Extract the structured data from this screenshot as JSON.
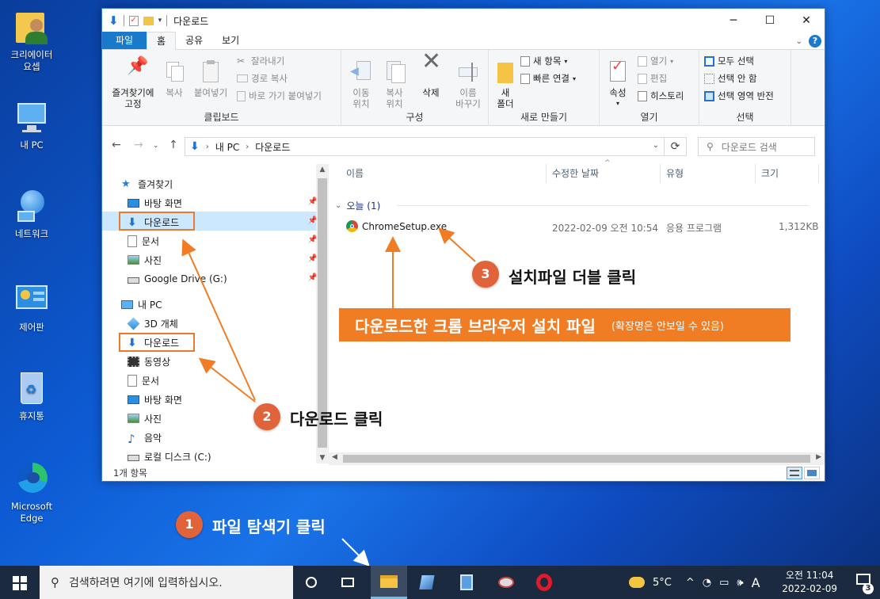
{
  "desktop": {
    "icons": [
      {
        "label": "크리에이터\n요셉"
      },
      {
        "label": "내 PC"
      },
      {
        "label": "네트워크"
      },
      {
        "label": "제어판"
      },
      {
        "label": "휴지통"
      },
      {
        "label": "Microsoft\nEdge"
      }
    ]
  },
  "window": {
    "title": "다운로드",
    "tabs": [
      "파일",
      "홈",
      "공유",
      "보기"
    ],
    "ribbon": {
      "clipboard": {
        "group": "클립보드",
        "pin": "즐겨찾기에\n고정",
        "copy": "복사",
        "paste": "붙여넣기",
        "cut": "잘라내기",
        "copy_path": "경로 복사",
        "paste_shortcut": "바로 가기 붙여넣기"
      },
      "organize": {
        "group": "구성",
        "move": "이동\n위치",
        "copy_to": "복사\n위치",
        "delete": "삭제",
        "rename": "이름\n바꾸기"
      },
      "new": {
        "group": "새로 만들기",
        "new_folder": "새\n폴더",
        "new_item": "새 항목",
        "easy_access": "빠른 연결"
      },
      "open": {
        "group": "열기",
        "properties": "속성",
        "open": "열기",
        "edit": "편집",
        "history": "히스토리"
      },
      "select": {
        "group": "선택",
        "select_all": "모두 선택",
        "select_none": "선택 안 함",
        "invert": "선택 영역 반전"
      }
    },
    "address": {
      "segments": [
        "내 PC",
        "다운로드"
      ],
      "search_placeholder": "다운로드 검색"
    },
    "nav": {
      "quick_access": "즐겨찾기",
      "quick_items": [
        "바탕 화면",
        "다운로드",
        "문서",
        "사진",
        "Google Drive (G:)"
      ],
      "this_pc": "내 PC",
      "pc_items": [
        "3D 개체",
        "다운로드",
        "동영상",
        "문서",
        "바탕 화면",
        "사진",
        "음악",
        "로컬 디스크 (C:)"
      ]
    },
    "columns": [
      "이름",
      "수정한 날짜",
      "유형",
      "크기"
    ],
    "group_header": "오늘 (1)",
    "files": [
      {
        "name": "ChromeSetup.exe",
        "modified": "2022-02-09 오전 10:54",
        "type": "응용 프로그램",
        "size": "1,312KB"
      }
    ],
    "status": "1개 항목"
  },
  "annotations": {
    "step1": {
      "num": "1",
      "text": "파일 탐색기 클릭"
    },
    "step2": {
      "num": "2",
      "text": "다운로드 클릭"
    },
    "step3": {
      "num": "3",
      "text": "설치파일 더블 클릭"
    },
    "banner_main": "다운로드한 크롬 브라우저 설치 파일",
    "banner_sub": "(확장명은 안보일 수 있음)"
  },
  "taskbar": {
    "search_placeholder": "검색하려면 여기에 입력하십시오.",
    "weather": "5°C",
    "ime": "A",
    "time": "오전 11:04",
    "date": "2022-02-09",
    "notifications": "3"
  },
  "colors": {
    "accent": "#1979ca",
    "annotation": "#e0633a",
    "banner": "#f07d24"
  }
}
